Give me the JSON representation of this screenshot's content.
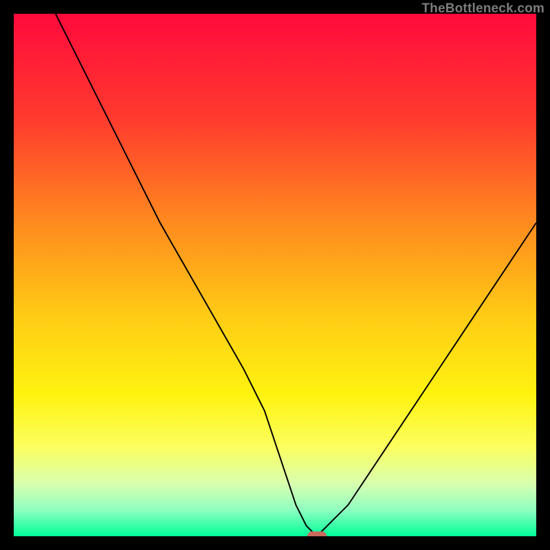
{
  "watermark": "TheBottleneck.com",
  "colors": {
    "frame": "#000000",
    "gradient_stops": [
      {
        "pct": 0,
        "color": "#ff0a3c"
      },
      {
        "pct": 20,
        "color": "#ff3a2e"
      },
      {
        "pct": 40,
        "color": "#ff8a1f"
      },
      {
        "pct": 58,
        "color": "#ffcc15"
      },
      {
        "pct": 73,
        "color": "#fff310"
      },
      {
        "pct": 83,
        "color": "#fbff60"
      },
      {
        "pct": 90,
        "color": "#d8ffb0"
      },
      {
        "pct": 95,
        "color": "#8effc0"
      },
      {
        "pct": 100,
        "color": "#00ff99"
      }
    ],
    "curve": "#000000",
    "marker": "#c86a5e"
  },
  "chart_data": {
    "type": "line",
    "title": "",
    "xlabel": "",
    "ylabel": "",
    "xlim": [
      0,
      100
    ],
    "ylim": [
      0,
      100
    ],
    "grid": false,
    "legend_position": "none",
    "series": [
      {
        "name": "bottleneck-curve",
        "x": [
          8,
          12,
          16,
          20,
          24,
          28,
          32,
          36,
          40,
          44,
          48,
          50,
          52,
          54,
          56,
          58,
          60,
          64,
          68,
          72,
          76,
          80,
          84,
          88,
          92,
          96,
          100
        ],
        "values": [
          100,
          92,
          84,
          76,
          68,
          60,
          53,
          46,
          39,
          32,
          24,
          18,
          12,
          6,
          2,
          0,
          2,
          6,
          12,
          18,
          24,
          30,
          36,
          42,
          48,
          54,
          60
        ]
      }
    ],
    "annotations": [
      {
        "name": "optimal-point",
        "x": 58,
        "y": 0
      }
    ]
  }
}
